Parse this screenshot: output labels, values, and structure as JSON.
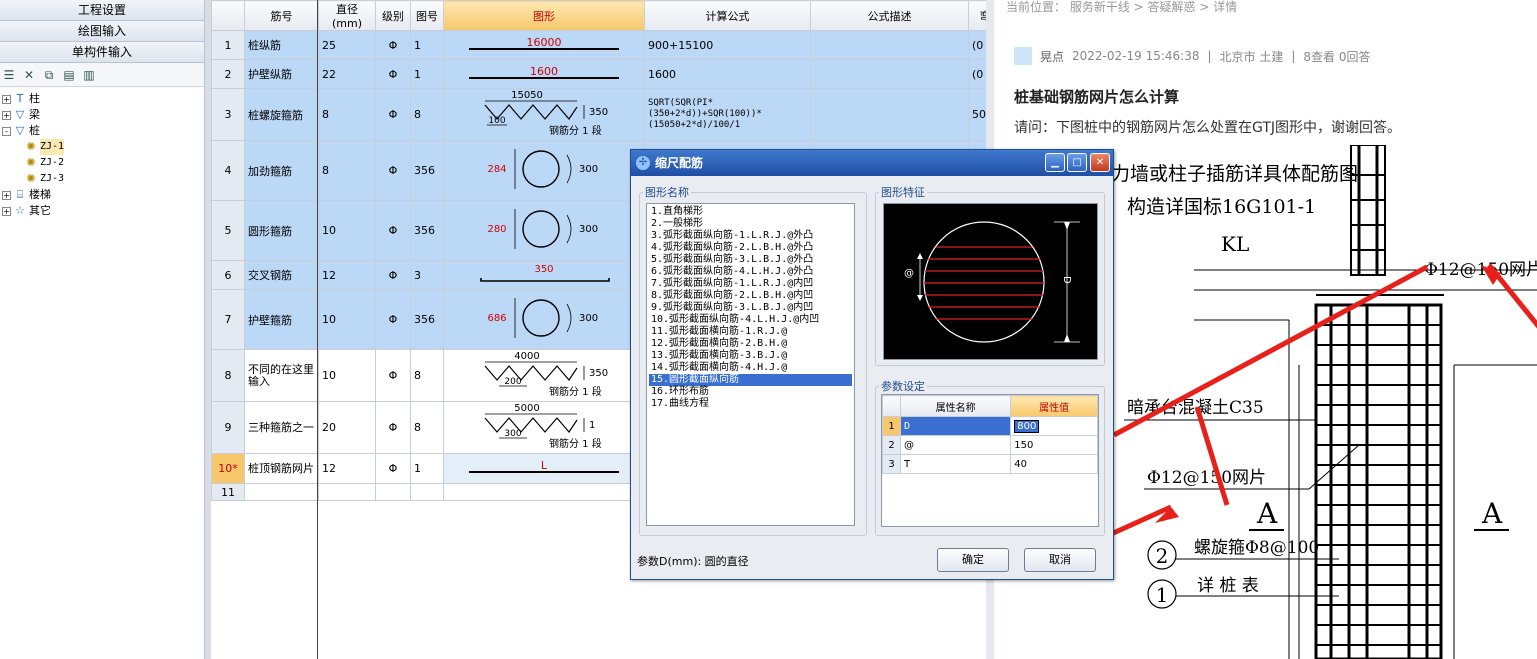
{
  "left_panel": {
    "nav_buttons": [
      "工程设置",
      "绘图输入",
      "单构件输入"
    ],
    "tree": {
      "items": [
        {
          "expander": "+",
          "label": "柱",
          "icon": "column-icon"
        },
        {
          "expander": "+",
          "label": "梁",
          "icon": "beam-icon"
        },
        {
          "expander": "-",
          "label": "桩",
          "icon": "pile-icon"
        },
        {
          "expander": "",
          "label": "ZJ-1",
          "icon": "gear-icon"
        },
        {
          "expander": "",
          "label": "ZJ-2",
          "icon": "gear-icon"
        },
        {
          "expander": "",
          "label": "ZJ-3",
          "icon": "gear-icon"
        },
        {
          "expander": "+",
          "label": "楼梯",
          "icon": "stair-icon"
        },
        {
          "expander": "+",
          "label": "其它",
          "icon": "star-icon"
        }
      ]
    }
  },
  "grid": {
    "headers": [
      "",
      "筋号",
      "直径(mm)",
      "级别",
      "图号",
      "图形",
      "计算公式",
      "公式描述",
      "弯"
    ],
    "rows": [
      {
        "n": "1",
        "name": "桩纵筋",
        "dia": "25",
        "grade": "Φ",
        "fig": "1",
        "shape_text": "16000",
        "formula": "900+15100",
        "tail": "(0"
      },
      {
        "n": "2",
        "name": "护壁纵筋",
        "dia": "22",
        "grade": "Φ",
        "fig": "1",
        "shape_text": "1600",
        "formula": "1600",
        "tail": "(0"
      },
      {
        "n": "3",
        "name": "桩螺旋箍筋",
        "dia": "8",
        "grade": "Φ",
        "fig": "8",
        "shape_text": "15050",
        "shape_h": "350",
        "shape_s": "100",
        "shape_seg": "钢筋分 1 段",
        "formula": "SQRT(SQR(PI*(350+2*d))+SQR(100))*(15050+2*d)/100/1",
        "tail": "50"
      },
      {
        "n": "4",
        "name": "加劲箍筋",
        "dia": "8",
        "grade": "Φ",
        "fig": "356",
        "shape_text": "284",
        "shape_d": "300"
      },
      {
        "n": "5",
        "name": "圆形箍筋",
        "dia": "10",
        "grade": "Φ",
        "fig": "356",
        "shape_text": "280",
        "shape_d": "300"
      },
      {
        "n": "6",
        "name": "交叉钢筋",
        "dia": "12",
        "grade": "Φ",
        "fig": "3",
        "shape_text": "350"
      },
      {
        "n": "7",
        "name": "护壁箍筋",
        "dia": "10",
        "grade": "Φ",
        "fig": "356",
        "shape_text": "686",
        "shape_d": "300"
      },
      {
        "n": "8",
        "name": "不同的在这里输入",
        "dia": "10",
        "grade": "Φ",
        "fig": "8",
        "shape_text": "4000",
        "shape_h": "350",
        "shape_s": "200",
        "shape_seg": "钢筋分 1 段"
      },
      {
        "n": "9",
        "name": "三种箍筋之一",
        "dia": "20",
        "grade": "Φ",
        "fig": "8",
        "shape_text": "5000",
        "shape_h": "1",
        "shape_s": "300",
        "shape_seg": "钢筋分 1 段"
      },
      {
        "n": "10*",
        "name": "桩顶钢筋网片",
        "dia": "12",
        "grade": "Φ",
        "fig": "1",
        "shape_text": "L"
      },
      {
        "n": "11"
      }
    ]
  },
  "right_page": {
    "crumb": "当前位置： 服务新干线 > 答疑解惑 > 详情",
    "author": "晃点",
    "datetime": "2022-02-19 15:46:38",
    "location": "北京市  土建",
    "stats": "8查看  0回答",
    "title": "桩基础钢筋网片怎么计算",
    "question": "请问：下图桩中的钢筋网片怎么处置在GTJ图形中，谢谢回答。",
    "drawing": {
      "t1": "力墙或柱子插筋详具体配筋图",
      "t2": "构造详国标16G101-1",
      "kl": "KL",
      "mesh1": "Φ12@150网片",
      "conc": "暗承台混凝土C35",
      "mesh2": "Φ12@150网片",
      "a1": "A",
      "a2": "A",
      "spiral": "螺旋箍Φ8@100",
      "tab": "详 桩 表",
      "c2": "2",
      "c1": "1"
    }
  },
  "dialog": {
    "title": "缩尺配筋",
    "list_label": "图形名称",
    "feature_label": "图形特征",
    "param_label": "参数设定",
    "shapes": [
      "1.直角梯形",
      "2.一般梯形",
      "3.弧形截面纵向筋-1.L.R.J.@外凸",
      "4.弧形截面纵向筋-2.L.B.H.@外凸",
      "5.弧形截面纵向筋-3.L.B.J.@外凸",
      "6.弧形截面纵向筋-4.L.H.J.@外凸",
      "7.弧形截面纵向筋-1.L.R.J.@内凹",
      "8.弧形截面纵向筋-2.L.B.H.@内凹",
      "9.弧形截面纵向筋-3.L.B.J.@内凹",
      "10.弧形截面纵向筋-4.L.H.J.@内凹",
      "11.弧形截面横向筋-1.R.J.@",
      "12.弧形截面横向筋-2.B.H.@",
      "13.弧形截面横向筋-3.B.J.@",
      "14.弧形截面横向筋-4.H.J.@",
      "15.圆形截面纵向筋",
      "16.环形布筋",
      "17.曲线方程"
    ],
    "selected_index": 14,
    "fig_labels": {
      "at": "@",
      "d": "D"
    },
    "params": {
      "headers": [
        "",
        "属性名称",
        "属性值"
      ],
      "rows": [
        {
          "n": "1",
          "name": "D",
          "value": "800"
        },
        {
          "n": "2",
          "name": "@",
          "value": "150"
        },
        {
          "n": "3",
          "name": "T",
          "value": "40"
        }
      ]
    },
    "footer_text": "参数D(mm): 圆的直径",
    "ok": "确定",
    "cancel": "取消"
  },
  "colors": {
    "accent": "#3a6fd1",
    "row_highlight": "#bcd8f7",
    "annotation_arrow": "#e8201a"
  }
}
